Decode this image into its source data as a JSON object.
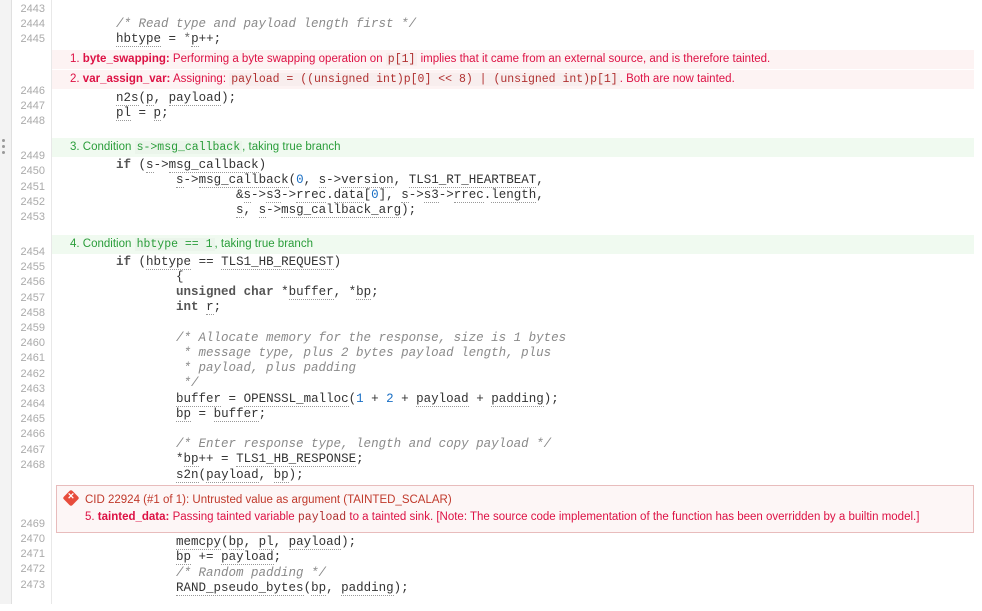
{
  "lines": {
    "l2443": "",
    "l2444": "        /* Read type and payload length first */",
    "l2445": "        hbtype = *p++;",
    "l2446": "        n2s(p, payload);",
    "l2447": "        pl = p;",
    "l2448": "",
    "l2449": "        if (s->msg_callback)",
    "l2450": "                s->msg_callback(0, s->version, TLS1_RT_HEARTBEAT,",
    "l2451": "                        &s->s3->rrec.data[0], s->s3->rrec.length,",
    "l2452": "                        s, s->msg_callback_arg);",
    "l2453": "",
    "l2454": "        if (hbtype == TLS1_HB_REQUEST)",
    "l2455": "                {",
    "l2456": "                unsigned char *buffer, *bp;",
    "l2457": "                int r;",
    "l2458": "",
    "l2459": "                /* Allocate memory for the response, size is 1 bytes",
    "l2460": "                 * message type, plus 2 bytes payload length, plus",
    "l2461": "                 * payload, plus padding",
    "l2462": "                 */",
    "l2463": "                buffer = OPENSSL_malloc(1 + 2 + payload + padding);",
    "l2464": "                bp = buffer;",
    "l2465": "",
    "l2466": "                /* Enter response type, length and copy payload */",
    "l2467": "                *bp++ = TLS1_HB_RESPONSE;",
    "l2468": "                s2n(payload, bp);",
    "l2469": "                memcpy(bp, pl, payload);",
    "l2470": "                bp += payload;",
    "l2471": "                /* Random padding */",
    "l2472": "                RAND_pseudo_bytes(bp, padding);",
    "l2473": ""
  },
  "lineNums": [
    "2443",
    "2444",
    "2445",
    "2446",
    "2447",
    "2448",
    "2449",
    "2450",
    "2451",
    "2452",
    "2453",
    "2454",
    "2455",
    "2456",
    "2457",
    "2458",
    "2459",
    "2460",
    "2461",
    "2462",
    "2463",
    "2464",
    "2465",
    "2466",
    "2467",
    "2468",
    "2469",
    "2470",
    "2471",
    "2472",
    "2473"
  ],
  "annot1": {
    "num": "1.",
    "kw": "byte_swapping:",
    "pre": "Performing a byte swapping operation on ",
    "code": "p[1]",
    "post": " implies that it came from an external source, and is therefore tainted."
  },
  "annot2": {
    "num": "2.",
    "kw": "var_assign_var:",
    "pre": "Assigning: ",
    "code": "payload = ((unsigned int)p[0] << 8) | (unsigned int)p[1]",
    "post": ". Both are now tainted."
  },
  "annot3": {
    "num": "3.",
    "pre": "Condition ",
    "code": "s->msg_callback",
    "post": ", taking true branch"
  },
  "annot4": {
    "num": "4.",
    "pre": "Condition ",
    "code": "hbtype == 1",
    "post": ", taking true branch"
  },
  "defect": {
    "header": "CID 22924 (#1 of 1): Untrusted value as argument (TAINTED_SCALAR)",
    "num": "5.",
    "kw": "tainted_data:",
    "pre": "Passing tainted variable ",
    "code": "payload",
    "post": " to a tainted sink. [Note: The source code implementation of the function has been overridden by a builtin model.]"
  }
}
